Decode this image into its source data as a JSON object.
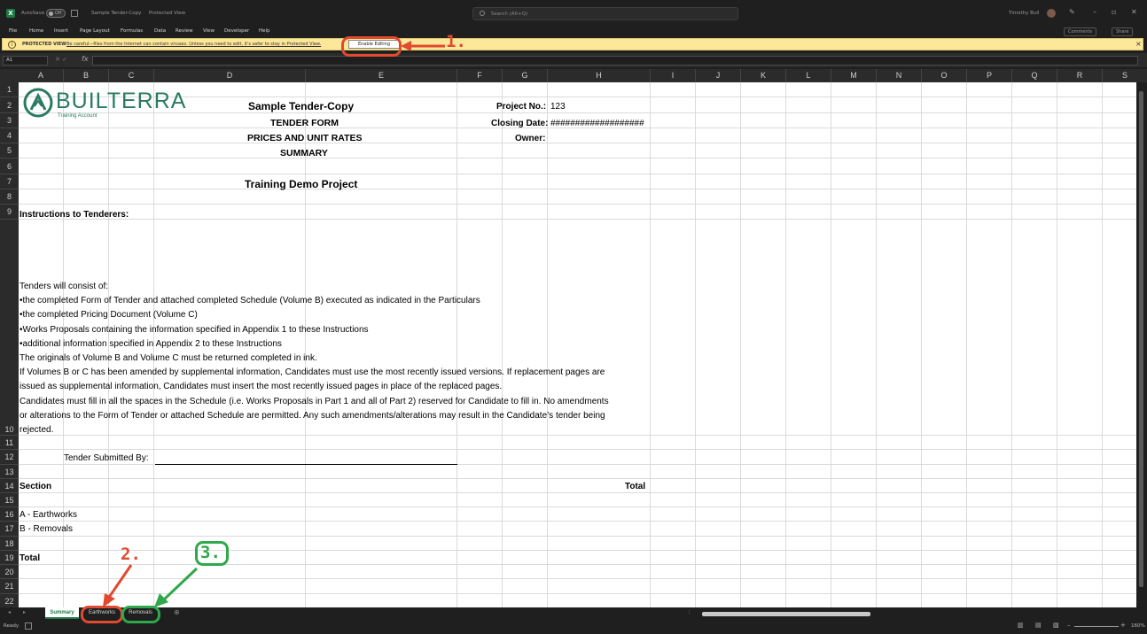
{
  "titlebar": {
    "autosave_label": "AutoSave",
    "autosave_state": "Off",
    "doc_title": "Sample Tender-Copy",
    "doc_view": "Protected View",
    "search_placeholder": "Search (Alt+Q)",
    "user_name": "Timothy Bull"
  },
  "menu": [
    "File",
    "Home",
    "Insert",
    "Page Layout",
    "Formulas",
    "Data",
    "Review",
    "View",
    "Developer",
    "Help"
  ],
  "ribbon_right": {
    "comments": "Comments",
    "share": "Share"
  },
  "protected_view": {
    "label": "PROTECTED VIEW",
    "message": "Be careful—files from the Internet can contain viruses. Unless you need to edit, it's safer to stay in Protected View.",
    "enable_button": "Enable Editing"
  },
  "annotations": {
    "n1": "1.",
    "n2": "2.",
    "n3": "3."
  },
  "formula_bar": {
    "name_box": "A1",
    "fx": "fx"
  },
  "columns": [
    "A",
    "B",
    "C",
    "D",
    "E",
    "F",
    "G",
    "H",
    "I",
    "J",
    "K",
    "L",
    "M",
    "N",
    "O",
    "P",
    "Q",
    "R",
    "S"
  ],
  "rows": [
    "1",
    "2",
    "3",
    "4",
    "5",
    "6",
    "7",
    "8",
    "9",
    "10",
    "11",
    "12",
    "13",
    "14",
    "15",
    "16",
    "17",
    "18",
    "19",
    "20",
    "21",
    "22"
  ],
  "logo": {
    "name": "BUILTERRA",
    "subtitle": "Training Account"
  },
  "sheet": {
    "title": "Sample Tender-Copy",
    "subtitle1": "TENDER FORM",
    "subtitle2": "PRICES AND UNIT RATES",
    "subtitle3": "SUMMARY",
    "project_name": "Training Demo Project",
    "project_no_label": "Project No.:",
    "project_no_value": "123",
    "closing_date_label": "Closing Date:",
    "closing_date_value": "###################",
    "owner_label": "Owner:",
    "instructions_header": "Instructions to Tenderers:",
    "instructions": [
      "Tenders will consist of:",
      "•the completed Form of Tender and attached completed Schedule (Volume B) executed as indicated in the Particulars",
      "•the completed Pricing Document (Volume C)",
      "•Works Proposals containing the information specified in Appendix 1 to these Instructions",
      "•additional information specified in Appendix 2 to these Instructions",
      "The originals of Volume B and Volume C must be returned completed in ink.",
      "If Volumes B or C has been amended by supplemental information, Candidates must use the most recently issued versions. If replacement pages are",
      "issued as supplemental information, Candidates must insert the most recently issued pages in place of the replaced pages.",
      "Candidates must fill in all the spaces in the Schedule (i.e. Works Proposals in Part 1 and all of Part 2) reserved for Candidate to fill in. No amendments",
      "or alterations to the Form of Tender or attached Schedule are permitted. Any such amendments/alterations may result in the Candidate’s tender being",
      "rejected."
    ],
    "tender_submitted_by": "Tender Submitted By:",
    "section_label": "Section",
    "total_header": "Total",
    "section_a": "A - Earthworks",
    "section_b": "B - Removals",
    "total_label": "Total"
  },
  "tabs": [
    "Summary",
    "Earthworks",
    "Removals"
  ],
  "status": {
    "ready": "Ready",
    "zoom": "160%"
  }
}
